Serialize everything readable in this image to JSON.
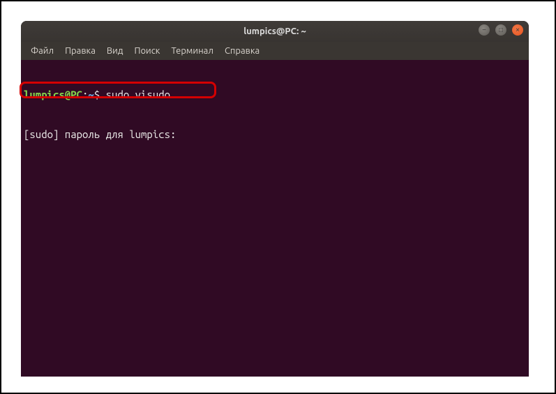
{
  "window": {
    "title": "lumpics@PC: ~"
  },
  "menu": [
    "Файл",
    "Правка",
    "Вид",
    "Поиск",
    "Терминал",
    "Справка"
  ],
  "controls": {
    "min": "−",
    "max": "□",
    "close": "×"
  },
  "prompt": {
    "user_host": "lumpics@PC",
    "sep": ":",
    "path": "~",
    "dollar": "$ "
  },
  "command": "sudo visudo",
  "output_line": "[sudo] пароль для lumpics: "
}
